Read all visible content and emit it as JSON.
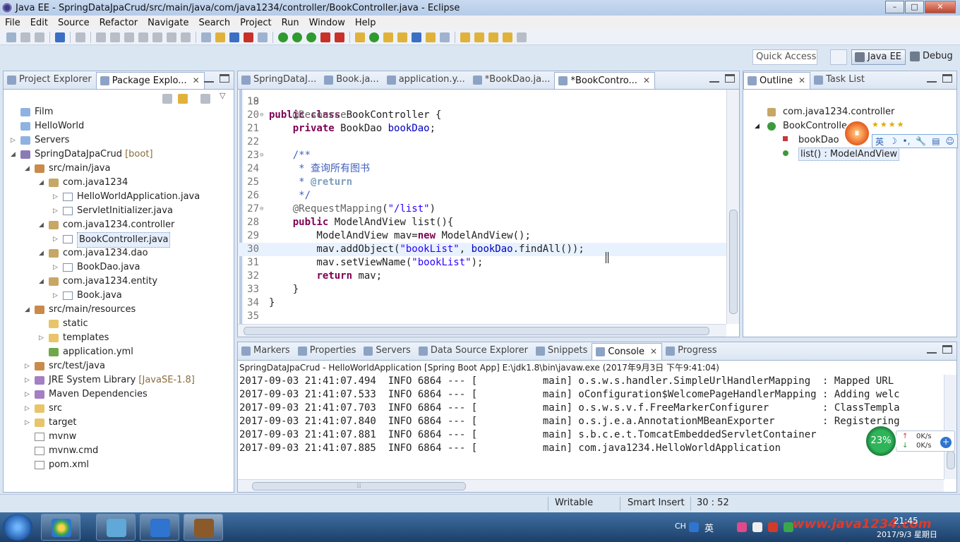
{
  "window": {
    "title": "Java EE - SpringDataJpaCrud/src/main/java/com/java1234/controller/BookController.java - Eclipse",
    "min_label": "–",
    "max_label": "□",
    "close_label": "✕"
  },
  "menu": [
    "File",
    "Edit",
    "Source",
    "Refactor",
    "Navigate",
    "Search",
    "Project",
    "Run",
    "Window",
    "Help"
  ],
  "quick_access": {
    "placeholder": "Quick Access"
  },
  "perspectives": {
    "javaee": "Java EE",
    "debug": "Debug"
  },
  "left_panel": {
    "tabs": [
      {
        "label": "Project Explorer",
        "active": false
      },
      {
        "label": "Package Explo...",
        "active": true
      }
    ],
    "tree": [
      {
        "label": "Film",
        "indent": 0,
        "arrow": "",
        "icon": "folder"
      },
      {
        "label": "HelloWorld",
        "indent": 0,
        "arrow": "",
        "icon": "folder"
      },
      {
        "label": "Servers",
        "indent": 0,
        "arrow": "▷",
        "icon": "folder"
      },
      {
        "label": "SpringDataJpaCrud",
        "deco": "[boot]",
        "indent": 0,
        "arrow": "◢",
        "icon": "proj"
      },
      {
        "label": "src/main/java",
        "indent": 1,
        "arrow": "◢",
        "icon": "pkgroot"
      },
      {
        "label": "com.java1234",
        "indent": 2,
        "arrow": "◢",
        "icon": "pkg"
      },
      {
        "label": "HelloWorldApplication.java",
        "indent": 3,
        "arrow": "▷",
        "icon": "java"
      },
      {
        "label": "ServletInitializer.java",
        "indent": 3,
        "arrow": "▷",
        "icon": "java"
      },
      {
        "label": "com.java1234.controller",
        "indent": 2,
        "arrow": "◢",
        "icon": "pkg"
      },
      {
        "label": "BookController.java",
        "indent": 3,
        "arrow": "▷",
        "icon": "java",
        "selected": true
      },
      {
        "label": "com.java1234.dao",
        "indent": 2,
        "arrow": "◢",
        "icon": "pkg"
      },
      {
        "label": "BookDao.java",
        "indent": 3,
        "arrow": "▷",
        "icon": "java"
      },
      {
        "label": "com.java1234.entity",
        "indent": 2,
        "arrow": "◢",
        "icon": "pkg"
      },
      {
        "label": "Book.java",
        "indent": 3,
        "arrow": "▷",
        "icon": "java"
      },
      {
        "label": "src/main/resources",
        "indent": 1,
        "arrow": "◢",
        "icon": "pkgroot"
      },
      {
        "label": "static",
        "indent": 2,
        "arrow": "",
        "icon": "yfolder"
      },
      {
        "label": "templates",
        "indent": 2,
        "arrow": "▷",
        "icon": "yfolder"
      },
      {
        "label": "application.yml",
        "indent": 2,
        "arrow": "",
        "icon": "yml"
      },
      {
        "label": "src/test/java",
        "indent": 1,
        "arrow": "▷",
        "icon": "pkgroot"
      },
      {
        "label": "JRE System Library",
        "deco": "[JavaSE-1.8]",
        "indent": 1,
        "arrow": "▷",
        "icon": "lib"
      },
      {
        "label": "Maven Dependencies",
        "indent": 1,
        "arrow": "▷",
        "icon": "lib"
      },
      {
        "label": "src",
        "indent": 1,
        "arrow": "▷",
        "icon": "yfolder"
      },
      {
        "label": "target",
        "indent": 1,
        "arrow": "▷",
        "icon": "yfolder"
      },
      {
        "label": "mvnw",
        "indent": 1,
        "arrow": "",
        "icon": "file"
      },
      {
        "label": "mvnw.cmd",
        "indent": 1,
        "arrow": "",
        "icon": "file"
      },
      {
        "label": "pom.xml",
        "indent": 1,
        "arrow": "",
        "icon": "file"
      }
    ]
  },
  "editor": {
    "tabs": [
      {
        "label": "SpringDataJ...",
        "active": false
      },
      {
        "label": "Book.ja...",
        "active": false
      },
      {
        "label": "application.y...",
        "active": false
      },
      {
        "label": "*BookDao.ja...",
        "active": false
      },
      {
        "label": "*BookContro...",
        "active": true
      }
    ],
    "first_partial_line": {
      "num": "18",
      "text": "public class BookController {"
    },
    "lines": [
      {
        "num": "19",
        "fold": "",
        "html": ""
      },
      {
        "num": "20",
        "fold": "⊖",
        "html": "    <span class='ann'>@Resource</span>"
      },
      {
        "num": "21",
        "fold": "",
        "html": "    <span class='kw'>private</span> BookDao <span class='fld'>bookDao</span>;"
      },
      {
        "num": "22",
        "fold": "",
        "html": ""
      },
      {
        "num": "23",
        "fold": "⊖",
        "html": "    <span class='cmt'>/**</span>"
      },
      {
        "num": "24",
        "fold": "",
        "html": "<span class='cmt'>     * 查询所有图书</span>"
      },
      {
        "num": "25",
        "fold": "",
        "html": "<span class='cmt'>     * </span><span class='jd'>@return</span>"
      },
      {
        "num": "26",
        "fold": "",
        "html": "<span class='cmt'>     */</span>"
      },
      {
        "num": "27",
        "fold": "⊖",
        "html": "    <span class='ann'>@RequestMapping</span>(<span class='str'>\"/list\"</span>)"
      },
      {
        "num": "28",
        "fold": "",
        "html": "    <span class='kw'>public</span> ModelAndView list(){"
      },
      {
        "num": "29",
        "fold": "",
        "html": "        ModelAndView mav=<span class='kw'>new</span> ModelAndView();"
      },
      {
        "num": "30",
        "fold": "",
        "html": "        mav.addObject(<span class='str'>\"bookList\"</span>, <span class='fld'>bookDao</span>.findAll());",
        "current": true
      },
      {
        "num": "31",
        "fold": "",
        "html": "        mav.setViewName(<span class='str'>\"bookList\"</span>);"
      },
      {
        "num": "32",
        "fold": "",
        "html": "        <span class='kw'>return</span> mav;"
      },
      {
        "num": "33",
        "fold": "",
        "html": "    }"
      },
      {
        "num": "34",
        "fold": "",
        "html": "}"
      },
      {
        "num": "35",
        "fold": "",
        "html": ""
      }
    ]
  },
  "outline": {
    "tabs": [
      {
        "label": "Outline",
        "active": true
      },
      {
        "label": "Task List",
        "active": false
      }
    ],
    "items": [
      {
        "label": "com.java1234.controller",
        "icon": "pkgdecl",
        "indent": 0,
        "arrow": ""
      },
      {
        "label": "BookControlle",
        "icon": "cls",
        "indent": 0,
        "arrow": "◢"
      },
      {
        "label": "bookDao",
        "icon": "fieldp",
        "indent": 1,
        "arrow": ""
      },
      {
        "label": "list() : ModelAndView",
        "icon": "methodg",
        "indent": 1,
        "arrow": "",
        "selected": true
      }
    ]
  },
  "ime_toolbar": {
    "stop": "⏸",
    "stars": "★★★★",
    "tools": [
      "英",
      "☽",
      "•,",
      "🔧",
      "▤",
      "☺"
    ]
  },
  "bottom": {
    "tabs": [
      {
        "label": "Markers",
        "active": false
      },
      {
        "label": "Properties",
        "active": false
      },
      {
        "label": "Servers",
        "active": false
      },
      {
        "label": "Data Source Explorer",
        "active": false
      },
      {
        "label": "Snippets",
        "active": false
      },
      {
        "label": "Console",
        "active": true
      },
      {
        "label": "Progress",
        "active": false
      }
    ],
    "console_title": "SpringDataJpaCrud - HelloWorldApplication [Spring Boot App] E:\\jdk1.8\\bin\\javaw.exe (2017年9月3日 下午9:41:04)",
    "console_lines": [
      "2017-09-03 21:41:07.494  INFO 6864 --- [           main] o.s.w.s.handler.SimpleUrlHandlerMapping  : Mapped URL",
      "2017-09-03 21:41:07.533  INFO 6864 --- [           main] oConfiguration$WelcomePageHandlerMapping : Adding welc",
      "2017-09-03 21:41:07.703  INFO 6864 --- [           main] o.s.w.s.v.f.FreeMarkerConfigurer         : ClassTempla",
      "2017-09-03 21:41:07.840  INFO 6864 --- [           main] o.s.j.e.a.AnnotationMBeanExporter        : Registering",
      "2017-09-03 21:41:07.881  INFO 6864 --- [           main] s.b.c.e.t.TomcatEmbeddedServletContainer",
      "2017-09-03 21:41:07.885  INFO 6864 --- [           main] com.java1234.HelloWorldApplication"
    ],
    "hscroll_grip": "⦙⦙⦙"
  },
  "net_widget": {
    "percent": "23%",
    "up": "0K/s",
    "down": "0K/s",
    "up_arrow": "↑",
    "down_arrow": "↓",
    "plus": "+"
  },
  "status": {
    "writable": "Writable",
    "insert_mode": "Smart Insert",
    "position": "30 : 52"
  },
  "taskbar": {
    "lang": "CH",
    "ime": "英",
    "watermark": "www.java1234.com",
    "time": "21:45",
    "date": "2017/9/3 星期日"
  }
}
